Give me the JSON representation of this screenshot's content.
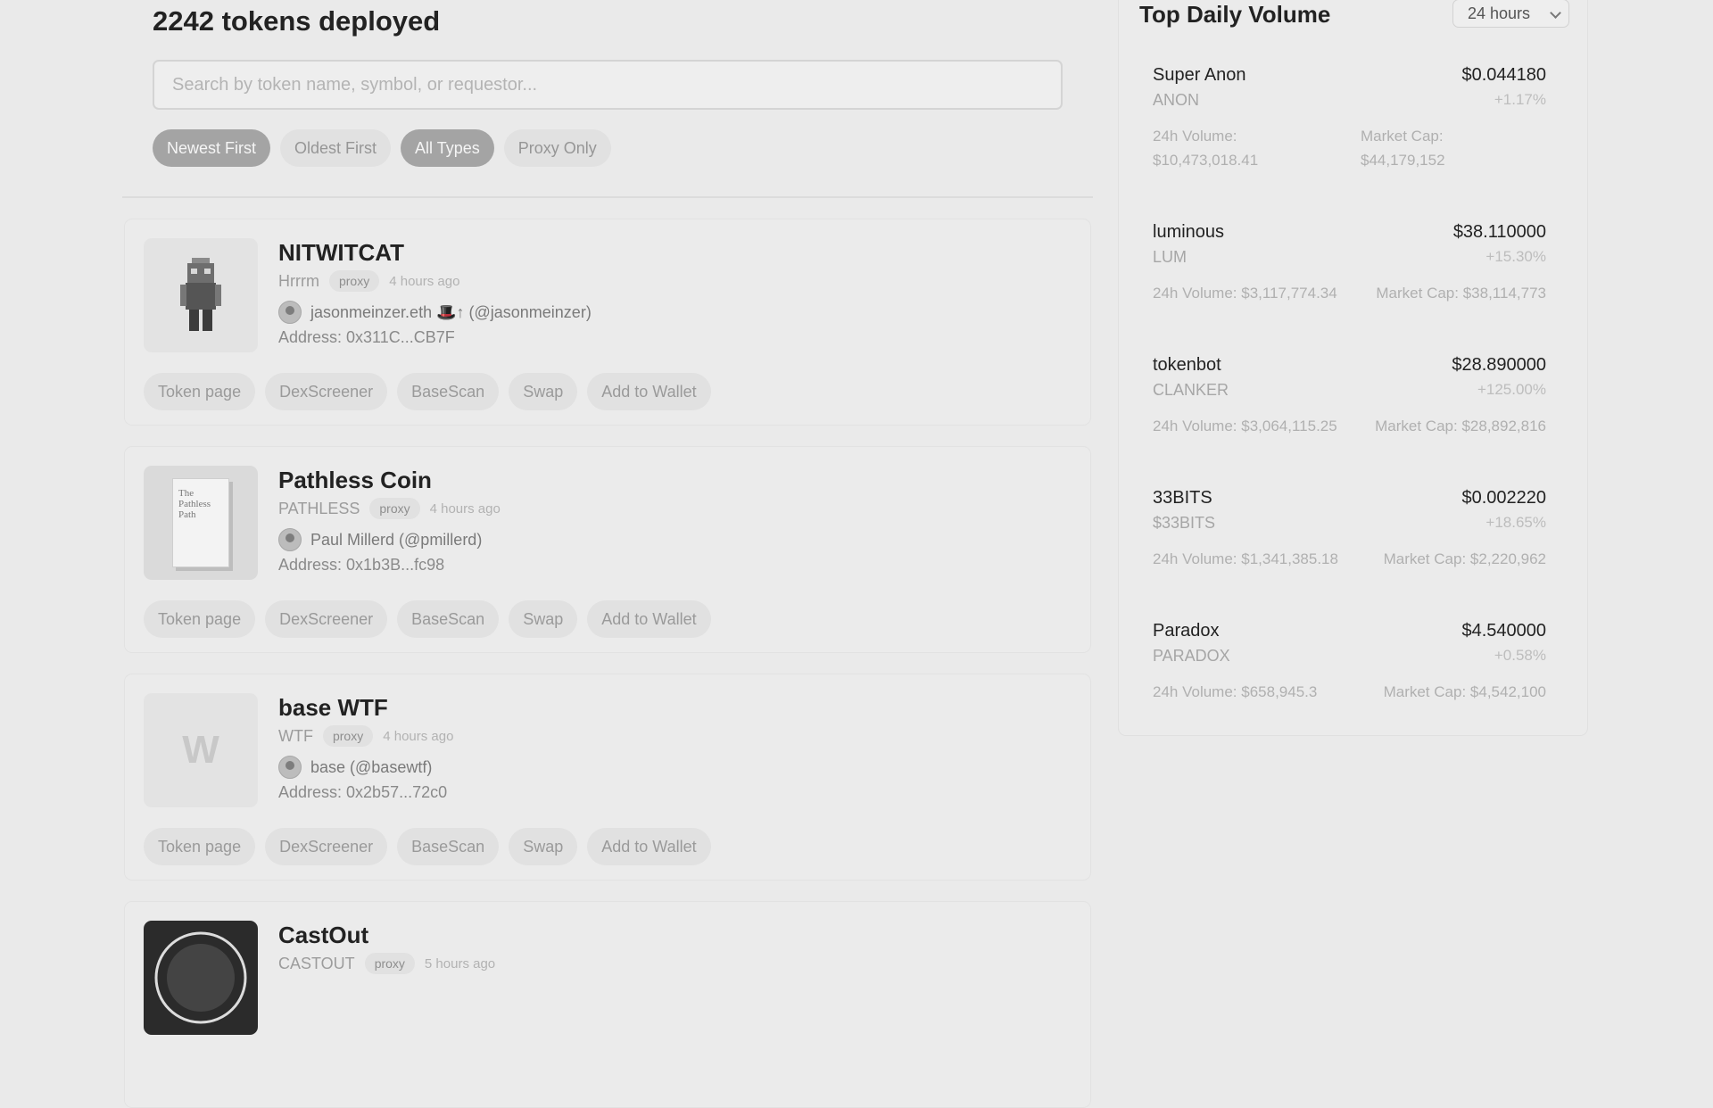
{
  "page": {
    "title": "2242 tokens deployed",
    "search_placeholder": "Search by token name, symbol, or requestor...",
    "filters": [
      {
        "label": "Newest First",
        "active": true
      },
      {
        "label": "Oldest First",
        "active": false
      },
      {
        "label": "All Types",
        "active": true
      },
      {
        "label": "Proxy Only",
        "active": false
      }
    ]
  },
  "tokens": [
    {
      "name": "NITWITCAT",
      "symbol": "Hrrrm",
      "tag": "proxy",
      "time": "4 hours ago",
      "user": "jasonmeinzer.eth 🎩↑ (@jasonmeinzer)",
      "address": "Address: 0x311C...CB7F",
      "thumb_icon": "pixel-cat-figure",
      "actions": [
        "Token page",
        "DexScreener",
        "BaseScan",
        "Swap",
        "Add to Wallet"
      ]
    },
    {
      "name": "Pathless Coin",
      "symbol": "PATHLESS",
      "tag": "proxy",
      "time": "4 hours ago",
      "user": "Paul Millerd (@pmillerd)",
      "address": "Address: 0x1b3B...fc98",
      "thumb_icon": "book-cover",
      "thumb_text": [
        "The",
        "Pathless",
        "Path"
      ],
      "actions": [
        "Token page",
        "DexScreener",
        "BaseScan",
        "Swap",
        "Add to Wallet"
      ]
    },
    {
      "name": "base WTF",
      "symbol": "WTF",
      "tag": "proxy",
      "time": "4 hours ago",
      "user": "base (@basewtf)",
      "address": "Address: 0x2b57...72c0",
      "thumb_letter": "W",
      "actions": [
        "Token page",
        "DexScreener",
        "BaseScan",
        "Swap",
        "Add to Wallet"
      ]
    },
    {
      "name": "CastOut",
      "symbol": "CASTOUT",
      "tag": "proxy",
      "time": "5 hours ago",
      "thumb_icon": "dark-badge-image"
    }
  ],
  "sidebar": {
    "title": "Top Daily Volume",
    "period": "24 hours",
    "items": [
      {
        "name": "Super Anon",
        "price": "$0.044180",
        "symbol": "ANON",
        "change": "+1.17%",
        "volume_label": "24h Volume:",
        "volume": "$10,473,018.41",
        "cap_label": "Market Cap:",
        "cap": "$44,179,152"
      },
      {
        "name": "luminous",
        "price": "$38.110000",
        "symbol": "LUM",
        "change": "+15.30%",
        "volume_label": "24h Volume:",
        "volume": "$3,117,774.34",
        "cap_label": "Market Cap:",
        "cap": "$38,114,773"
      },
      {
        "name": "tokenbot",
        "price": "$28.890000",
        "symbol": "CLANKER",
        "change": "+125.00%",
        "volume_label": "24h Volume:",
        "volume": "$3,064,115.25",
        "cap_label": "Market Cap:",
        "cap": "$28,892,816"
      },
      {
        "name": "33BITS",
        "price": "$0.002220",
        "symbol": "$33BITS",
        "change": "+18.65%",
        "volume_label": "24h Volume:",
        "volume": "$1,341,385.18",
        "cap_label": "Market Cap:",
        "cap": "$2,220,962"
      },
      {
        "name": "Paradox",
        "price": "$4.540000",
        "symbol": "PARADOX",
        "change": "+0.58%",
        "volume_label": "24h Volume:",
        "volume": "$658,945.3",
        "cap_label": "Market Cap:",
        "cap": "$4,542,100"
      }
    ]
  }
}
